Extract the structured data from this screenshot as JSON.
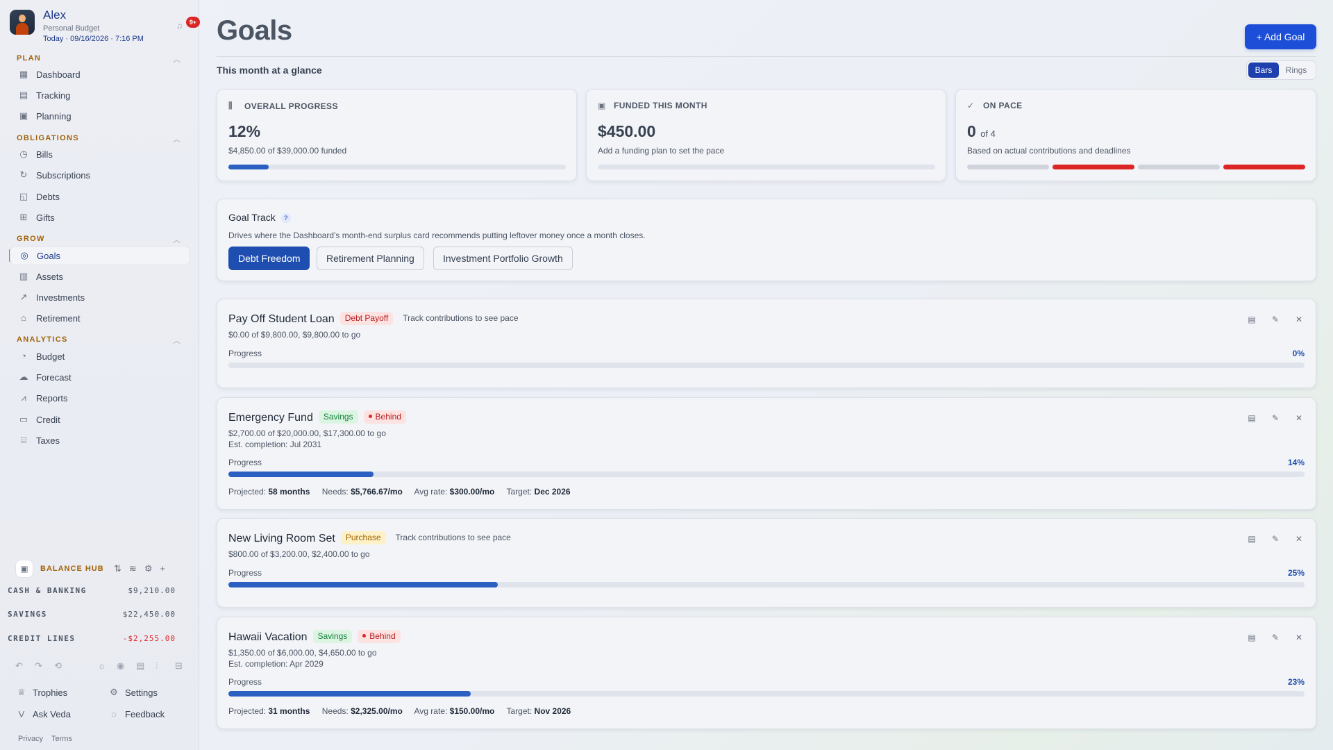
{
  "profile": {
    "name": "Alex",
    "subtitle": "Personal Budget",
    "date": "Today · 09/16/2026 · 7:16 PM",
    "badge": "9+"
  },
  "sidebar": {
    "sections": [
      {
        "title": "PLAN",
        "items": [
          {
            "label": "Dashboard",
            "icon": "dashboard-icon"
          },
          {
            "label": "Tracking",
            "icon": "tracking-icon"
          },
          {
            "label": "Planning",
            "icon": "calendar-icon"
          }
        ]
      },
      {
        "title": "OBLIGATIONS",
        "items": [
          {
            "label": "Bills",
            "icon": "bills-icon"
          },
          {
            "label": "Subscriptions",
            "icon": "refresh-icon"
          },
          {
            "label": "Debts",
            "icon": "debts-icon"
          },
          {
            "label": "Gifts",
            "icon": "gift-icon"
          }
        ]
      },
      {
        "title": "GROW",
        "items": [
          {
            "label": "Goals",
            "icon": "target-icon"
          },
          {
            "label": "Assets",
            "icon": "building-icon"
          },
          {
            "label": "Investments",
            "icon": "trend-icon"
          },
          {
            "label": "Retirement",
            "icon": "retirement-icon"
          }
        ]
      },
      {
        "title": "ANALYTICS",
        "items": [
          {
            "label": "Budget",
            "icon": "pie-icon"
          },
          {
            "label": "Forecast",
            "icon": "cloud-icon"
          },
          {
            "label": "Reports",
            "icon": "chart-icon"
          },
          {
            "label": "Credit",
            "icon": "card-icon"
          },
          {
            "label": "Taxes",
            "icon": "bank-icon"
          }
        ]
      }
    ],
    "active": "Goals"
  },
  "balance_hub": {
    "title": "BALANCE HUB",
    "rows": [
      {
        "label": "CASH & BANKING",
        "value": "$9,210.00"
      },
      {
        "label": "SAVINGS",
        "value": "$22,450.00"
      },
      {
        "label": "CREDIT LINES",
        "value": "-$2,255.00"
      }
    ]
  },
  "footer": {
    "trophies": "Trophies",
    "settings": "Settings",
    "ask": "Ask Veda",
    "feedback": "Feedback",
    "privacy": "Privacy",
    "terms": "Terms"
  },
  "main": {
    "title": "Goals",
    "add_goal": "+ Add Goal",
    "glance": "This month at a glance",
    "toggle": {
      "bars": "Bars",
      "rings": "Rings"
    },
    "stats": {
      "overall": {
        "caption": "OVERALL PROGRESS",
        "value": "12%",
        "desc": "$4,850.00 of $39,000.00 funded",
        "progress": 0.12
      },
      "funded": {
        "caption": "FUNDED THIS MONTH",
        "value": "$450.00",
        "desc": "Add a funding plan to set the pace"
      },
      "pace": {
        "caption": "ON PACE",
        "value": "0",
        "of": "of 4",
        "desc": "Based on actual contributions and deadlines",
        "segments": [
          "neutral",
          "behind",
          "neutral",
          "behind"
        ]
      }
    },
    "goal_track": {
      "title": "Goal Track",
      "help": "?",
      "desc": "Drives where the Dashboard's month-end surplus card recommends putting leftover money once a month closes.",
      "options": [
        "Debt Freedom",
        "Retirement Planning",
        "Investment Portfolio Growth"
      ],
      "selected": "Debt Freedom"
    },
    "goals": [
      {
        "name": "Pay Off Student Loan",
        "category": "Debt Payoff",
        "status": "",
        "note": "Track contributions to see pace",
        "amount": "$0.00 of $9,800.00, $9,800.00 to go",
        "est": "",
        "progress_label": "Progress",
        "pct": "0%",
        "progress": 0.0
      },
      {
        "name": "Emergency Fund",
        "category": "Savings",
        "status": "Behind",
        "note": "",
        "amount": "$2,700.00 of $20,000.00, $17,300.00 to go",
        "est": "Est. completion: Jul 2031",
        "progress_label": "Progress",
        "pct": "14%",
        "progress": 0.135,
        "meta": {
          "projected_label": "Projected:",
          "projected": "58 months",
          "needs_label": "Needs:",
          "needs": "$5,766.67/mo",
          "rate_label": "Avg rate:",
          "rate": "$300.00/mo",
          "target_label": "Target:",
          "target": "Dec 2026"
        }
      },
      {
        "name": "New Living Room Set",
        "category": "Purchase",
        "status": "",
        "note": "Track contributions to see pace",
        "amount": "$800.00 of $3,200.00, $2,400.00 to go",
        "est": "",
        "progress_label": "Progress",
        "pct": "25%",
        "progress": 0.25
      },
      {
        "name": "Hawaii Vacation",
        "category": "Savings",
        "status": "Behind",
        "note": "",
        "amount": "$1,350.00 of $6,000.00, $4,650.00 to go",
        "est": "Est. completion: Apr 2029",
        "progress_label": "Progress",
        "pct": "23%",
        "progress": 0.225,
        "meta": {
          "projected_label": "Projected:",
          "projected": "31 months",
          "needs_label": "Needs:",
          "needs": "$2,325.00/mo",
          "rate_label": "Avg rate:",
          "rate": "$150.00/mo",
          "target_label": "Target:",
          "target": "Nov 2026"
        }
      }
    ]
  },
  "colors": {
    "accent": "#1e4fb0",
    "behind": "#dc2626",
    "section": "#a16207"
  }
}
